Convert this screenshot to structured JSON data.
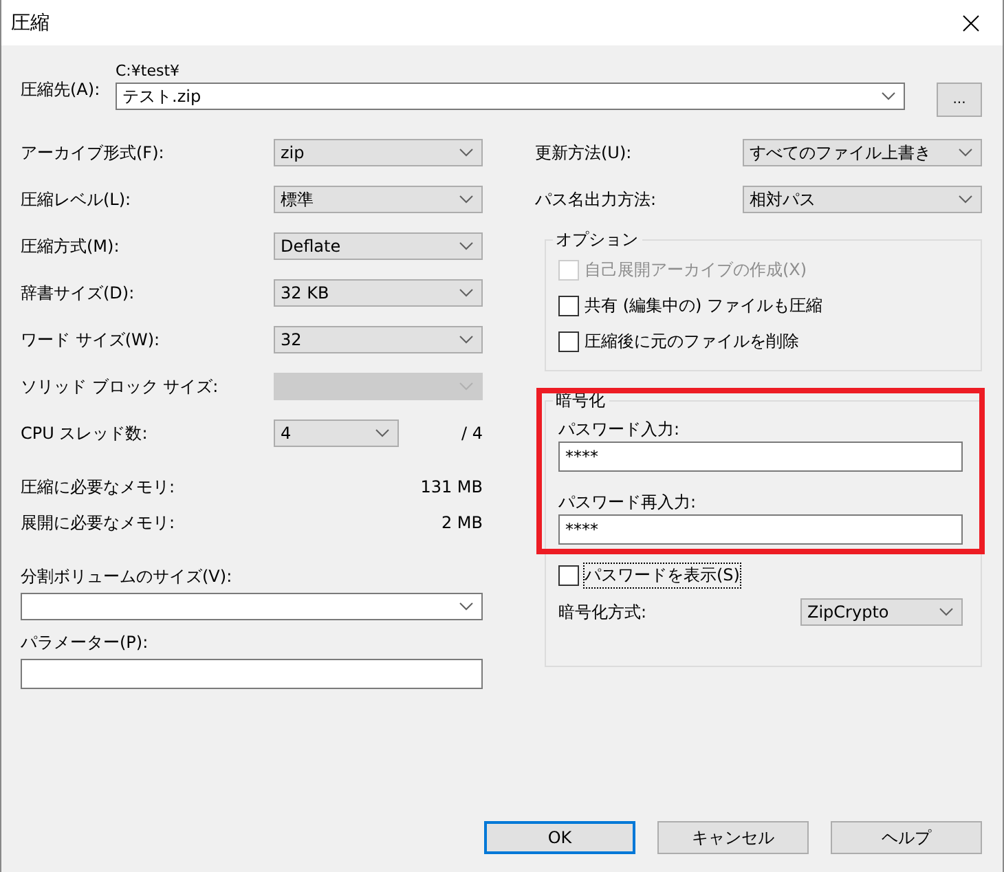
{
  "window": {
    "title": "圧縮"
  },
  "destination": {
    "label": "圧縮先(A):",
    "path": "C:¥test¥",
    "value": "テスト.zip",
    "browse": "..."
  },
  "left_settings": [
    {
      "label": "アーカイブ形式(F):",
      "value": "zip",
      "disabled": false
    },
    {
      "label": "圧縮レベル(L):",
      "value": "標準",
      "disabled": false
    },
    {
      "label": "圧縮方式(M):",
      "value": "Deflate",
      "disabled": false
    },
    {
      "label": "辞書サイズ(D):",
      "value": "32 KB",
      "disabled": false
    },
    {
      "label": "ワード サイズ(W):",
      "value": "32",
      "disabled": false
    },
    {
      "label": "ソリッド ブロック サイズ:",
      "disabled": true
    }
  ],
  "cpu_threads": {
    "label": "CPU スレッド数:",
    "value": "4",
    "max": "/ 4"
  },
  "memory": [
    {
      "label": "圧縮に必要なメモリ:",
      "value": "131 MB"
    },
    {
      "label": "展開に必要なメモリ:",
      "value": "2 MB"
    }
  ],
  "split_volume": {
    "label": "分割ボリュームのサイズ(V):"
  },
  "parameters": {
    "label": "パラメーター(P):"
  },
  "right_settings": [
    {
      "label": "更新方法(U):",
      "value": "すべてのファイル上書き"
    },
    {
      "label": "パス名出力方法:",
      "value": "相対パス"
    }
  ],
  "options": {
    "title": "オプション",
    "items": [
      {
        "label": "自己展開アーカイブの作成(X)",
        "checked": false,
        "disabled": true
      },
      {
        "label": "共有 (編集中の) ファイルも圧縮",
        "checked": false,
        "disabled": false
      },
      {
        "label": "圧縮後に元のファイルを削除",
        "checked": false,
        "disabled": false
      }
    ]
  },
  "encryption": {
    "title": "暗号化",
    "highlighted": true,
    "password_label": "パスワード入力:",
    "password": "****",
    "confirm_label": "パスワード再入力:",
    "confirm": "****",
    "show_password": {
      "label": "パスワードを表示(S)",
      "checked": false,
      "focused": true
    },
    "method_label": "暗号化方式:",
    "method": "ZipCrypto"
  },
  "buttons": [
    {
      "label": "OK",
      "default": true
    },
    {
      "label": "キャンセル",
      "default": false
    },
    {
      "label": "ヘルプ",
      "default": false
    }
  ]
}
